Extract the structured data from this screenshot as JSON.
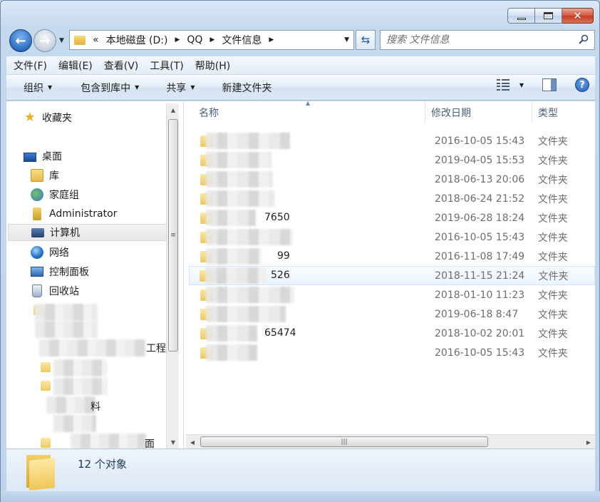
{
  "address": {
    "overflow": "«",
    "crumbs": [
      "本地磁盘 (D:)",
      "QQ",
      "文件信息"
    ]
  },
  "search": {
    "placeholder": "搜索 文件信息"
  },
  "menu": [
    "文件(F)",
    "编辑(E)",
    "查看(V)",
    "工具(T)",
    "帮助(H)"
  ],
  "toolbar": {
    "organize": "组织",
    "include_library": "包含到库中",
    "share": "共享",
    "new_folder": "新建文件夹"
  },
  "nav": {
    "favorites": "收藏夹",
    "desktop": "桌面",
    "libraries": "库",
    "homegroup": "家庭组",
    "user": "Administrator",
    "computer": "计算机",
    "network": "网络",
    "control_panel": "控制面板",
    "recycle_bin": "回收站",
    "partial_1": "工程",
    "partial_2": "料",
    "partial_3": "面"
  },
  "columns": {
    "name": "名称",
    "date": "修改日期",
    "type": "类型"
  },
  "files": [
    {
      "name_tail": "",
      "date": "2016-10-05 15:43",
      "type": "文件夹"
    },
    {
      "name_tail": "",
      "date": "2019-04-05 15:53",
      "type": "文件夹"
    },
    {
      "name_tail": "",
      "date": "2018-06-13 20:06",
      "type": "文件夹"
    },
    {
      "name_tail": "",
      "date": "2018-06-24 21:52",
      "type": "文件夹"
    },
    {
      "name_tail": "7650",
      "date": "2019-06-28 18:24",
      "type": "文件夹"
    },
    {
      "name_tail": "",
      "date": "2016-10-05 15:43",
      "type": "文件夹"
    },
    {
      "name_tail": "99",
      "date": "2016-11-08 17:49",
      "type": "文件夹"
    },
    {
      "name_tail": "526",
      "date": "2018-11-15 21:24",
      "type": "文件夹"
    },
    {
      "name_tail": "",
      "date": "2018-01-10 11:23",
      "type": "文件夹"
    },
    {
      "name_tail": "",
      "date": "2019-06-18 8:47",
      "type": "文件夹"
    },
    {
      "name_tail": "65474",
      "date": "2018-10-02 20:01",
      "type": "文件夹"
    },
    {
      "name_tail": "",
      "date": "2016-10-05 15:43",
      "type": "文件夹"
    }
  ],
  "status": {
    "count": "12 个对象"
  },
  "icons": {
    "back": "back-arrow-icon",
    "forward": "forward-arrow-icon",
    "refresh": "refresh-icon",
    "search": "search-icon",
    "views": "view-details-icon",
    "preview": "preview-pane-icon",
    "help": "help-icon"
  }
}
